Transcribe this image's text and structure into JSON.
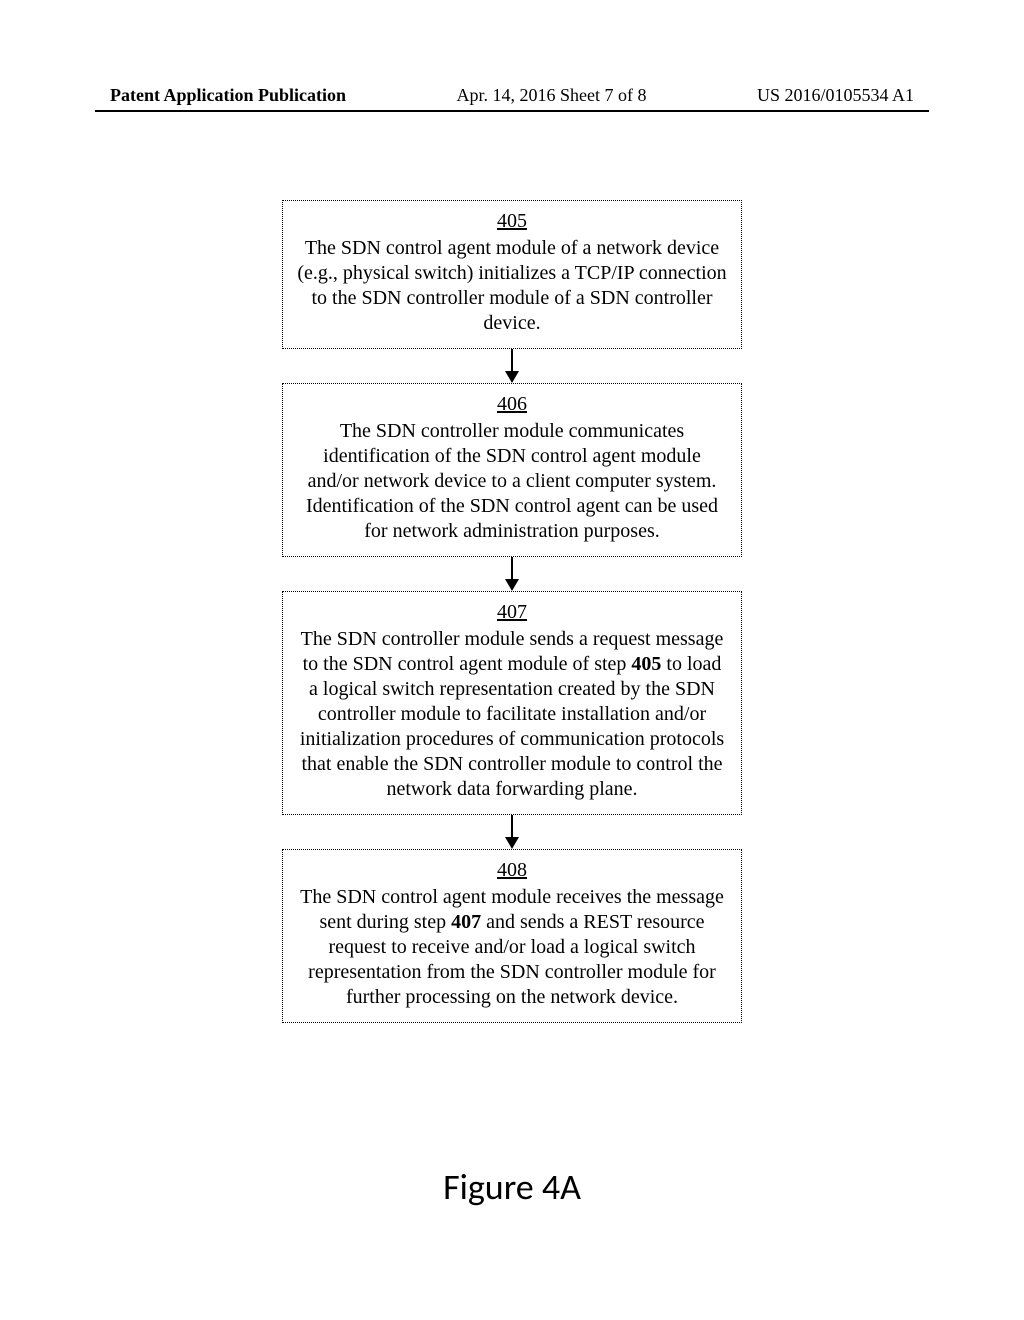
{
  "header": {
    "left": "Patent Application Publication",
    "center": "Apr. 14, 2016  Sheet 7 of 8",
    "right": "US 2016/0105534 A1"
  },
  "steps": [
    {
      "num": "405",
      "text": "The SDN control agent module of a network device (e.g., physical switch) initializes a TCP/IP connection to the SDN controller module of a SDN controller device."
    },
    {
      "num": "406",
      "text": "The SDN controller module communicates identification of the SDN control agent module and/or network device to a client computer system.  Identification of the SDN control agent can be used for network administration purposes."
    },
    {
      "num": "407",
      "text": "The SDN controller module sends a request message to the SDN control agent module of step <b>405</b> to load a logical switch representation created by the SDN controller module to facilitate installation and/or initialization procedures of communication protocols that enable the SDN controller module to control the network data forwarding plane."
    },
    {
      "num": "408",
      "text": "The SDN control agent module receives the message sent during step <b>407</b> and sends a REST resource request to receive and/or load a logical switch representation from the SDN controller module for further processing on the network device."
    }
  ],
  "caption": "Figure 4A"
}
